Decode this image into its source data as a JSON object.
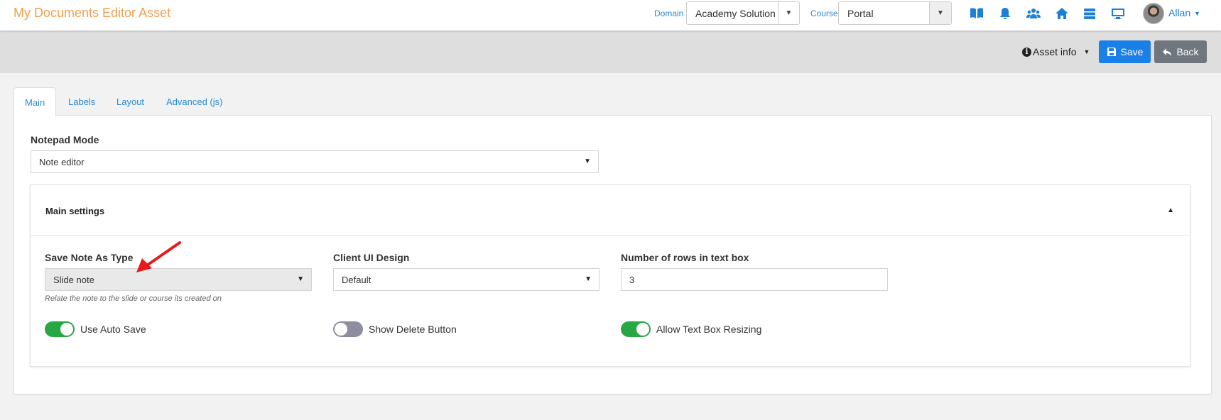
{
  "app": {
    "title": "My Documents Editor Asset"
  },
  "nav": {
    "domain_label": "Domain",
    "domain_value": "Academy Solution",
    "course_label": "Course",
    "course_value": "Portal",
    "icons": [
      "book-icon",
      "bell-icon",
      "users-icon",
      "home-icon",
      "server-icon",
      "monitor-icon"
    ],
    "user_name": "Allan"
  },
  "actions": {
    "asset_info_label": "Asset info",
    "save_label": "Save",
    "back_label": "Back"
  },
  "tabs": [
    {
      "label": "Main",
      "active": true
    },
    {
      "label": "Labels",
      "active": false
    },
    {
      "label": "Layout",
      "active": false
    },
    {
      "label": "Advanced (js)",
      "active": false
    }
  ],
  "main": {
    "notepad_mode_label": "Notepad Mode",
    "notepad_mode_value": "Note editor",
    "settings": {
      "title": "Main settings",
      "save_note_type_label": "Save Note As Type",
      "save_note_type_value": "Slide note",
      "save_note_type_hint": "Relate the note to the slide or course its created on",
      "client_ui_label": "Client UI Design",
      "client_ui_value": "Default",
      "rows_label": "Number of rows in text box",
      "rows_value": "3",
      "toggles": [
        {
          "label": "Use Auto Save",
          "on": true
        },
        {
          "label": "Show Delete Button",
          "on": false
        },
        {
          "label": "Allow Text Box Resizing",
          "on": true
        }
      ]
    }
  },
  "colors": {
    "title": "#f0a050",
    "primary": "#1a7fe6",
    "back": "#6f767d",
    "toggle_on": "#28a745",
    "toggle_off": "#8e8ea0",
    "annotation": "#e8191a"
  }
}
